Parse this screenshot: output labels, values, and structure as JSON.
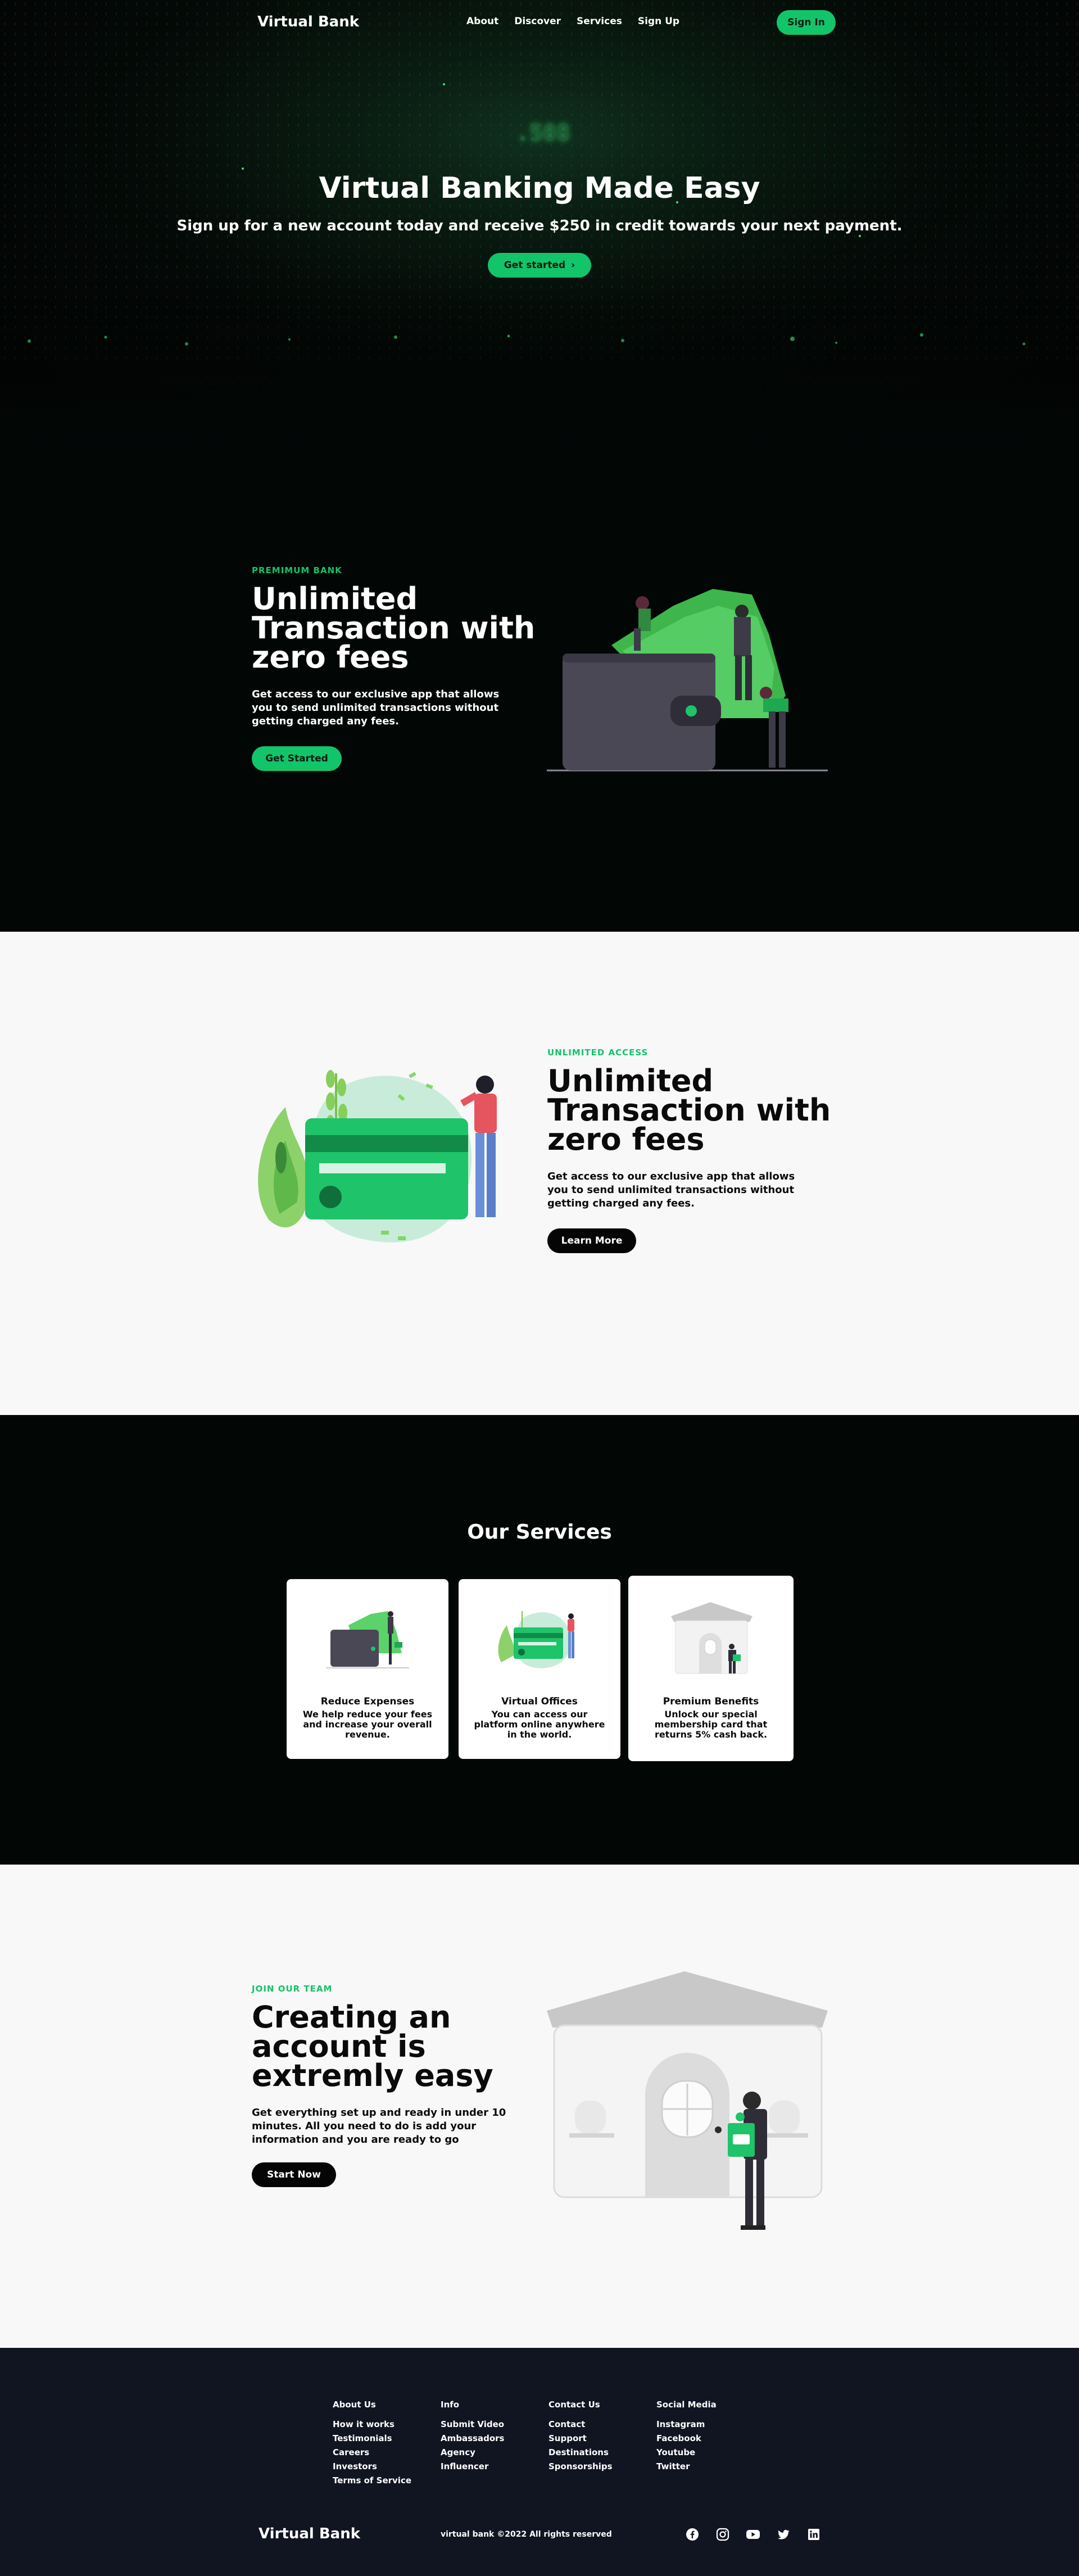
{
  "nav": {
    "logo": "Virtual Bank",
    "links": [
      "About",
      "Discover",
      "Services",
      "Sign Up"
    ],
    "signin": "Sign In"
  },
  "hero": {
    "display_number": ".508",
    "title": "Virtual Banking Made Easy",
    "subtitle": "Sign up for a new account today and receive $250 in credit towards your next payment.",
    "cta": "Get started",
    "cta_arrow": "›"
  },
  "premium": {
    "eyebrow": "PREMIMUM BANK",
    "heading": [
      "Unlimited",
      "Transaction with",
      "zero fees"
    ],
    "text": [
      "Get access to our exclusive app that allows",
      "you to send unlimited transactions without",
      "getting charged any fees."
    ],
    "cta": "Get Started"
  },
  "access": {
    "eyebrow": "UNLIMITED ACCESS",
    "heading": [
      "Unlimited",
      "Transaction with",
      "zero fees"
    ],
    "text": [
      "Get access to our exclusive app that allows",
      "you to send unlimited transactions without",
      "getting charged any fees."
    ],
    "cta": "Learn More"
  },
  "services": {
    "title": "Our Services",
    "cards": [
      {
        "title": "Reduce Expenses",
        "text": [
          "We help reduce your fees",
          "and increase your overall",
          "revenue."
        ]
      },
      {
        "title": "Virtual Offices",
        "text": [
          "You can access our",
          "platform online anywhere",
          "in the world."
        ]
      },
      {
        "title": "Premium Benefits",
        "text": [
          "Unlock our special",
          "membership card that",
          "returns 5% cash back."
        ]
      }
    ]
  },
  "join": {
    "eyebrow": "JOIN OUR TEAM",
    "heading": [
      "Creating an",
      "account is",
      "extremly easy"
    ],
    "text": [
      "Get everything set up and ready in under 10",
      "minutes. All you need to do is add your",
      "information and you are ready to go"
    ],
    "cta": "Start Now"
  },
  "footer": {
    "columns": [
      {
        "title": "About Us",
        "links": [
          "How it works",
          "Testimonials",
          "Careers",
          "Investors",
          "Terms of Service"
        ]
      },
      {
        "title": "Info",
        "links": [
          "Submit Video",
          "Ambassadors",
          "Agency",
          "Influencer"
        ]
      },
      {
        "title": "Contact Us",
        "links": [
          "Contact",
          "Support",
          "Destinations",
          "Sponsorships"
        ]
      },
      {
        "title": "Social Media",
        "links": [
          "Instagram",
          "Facebook",
          "Youtube",
          "Twitter"
        ]
      }
    ],
    "logo": "Virtual Bank",
    "copyright": "virtual bank ©2022 All rights reserved",
    "socials": [
      "facebook-icon",
      "instagram-icon",
      "youtube-icon",
      "twitter-icon",
      "linkedin-icon"
    ]
  },
  "colors": {
    "accent": "#12c46a",
    "dark_bg": "#020706",
    "light_bg": "#f8f8f8",
    "footer_bg": "#111421"
  }
}
